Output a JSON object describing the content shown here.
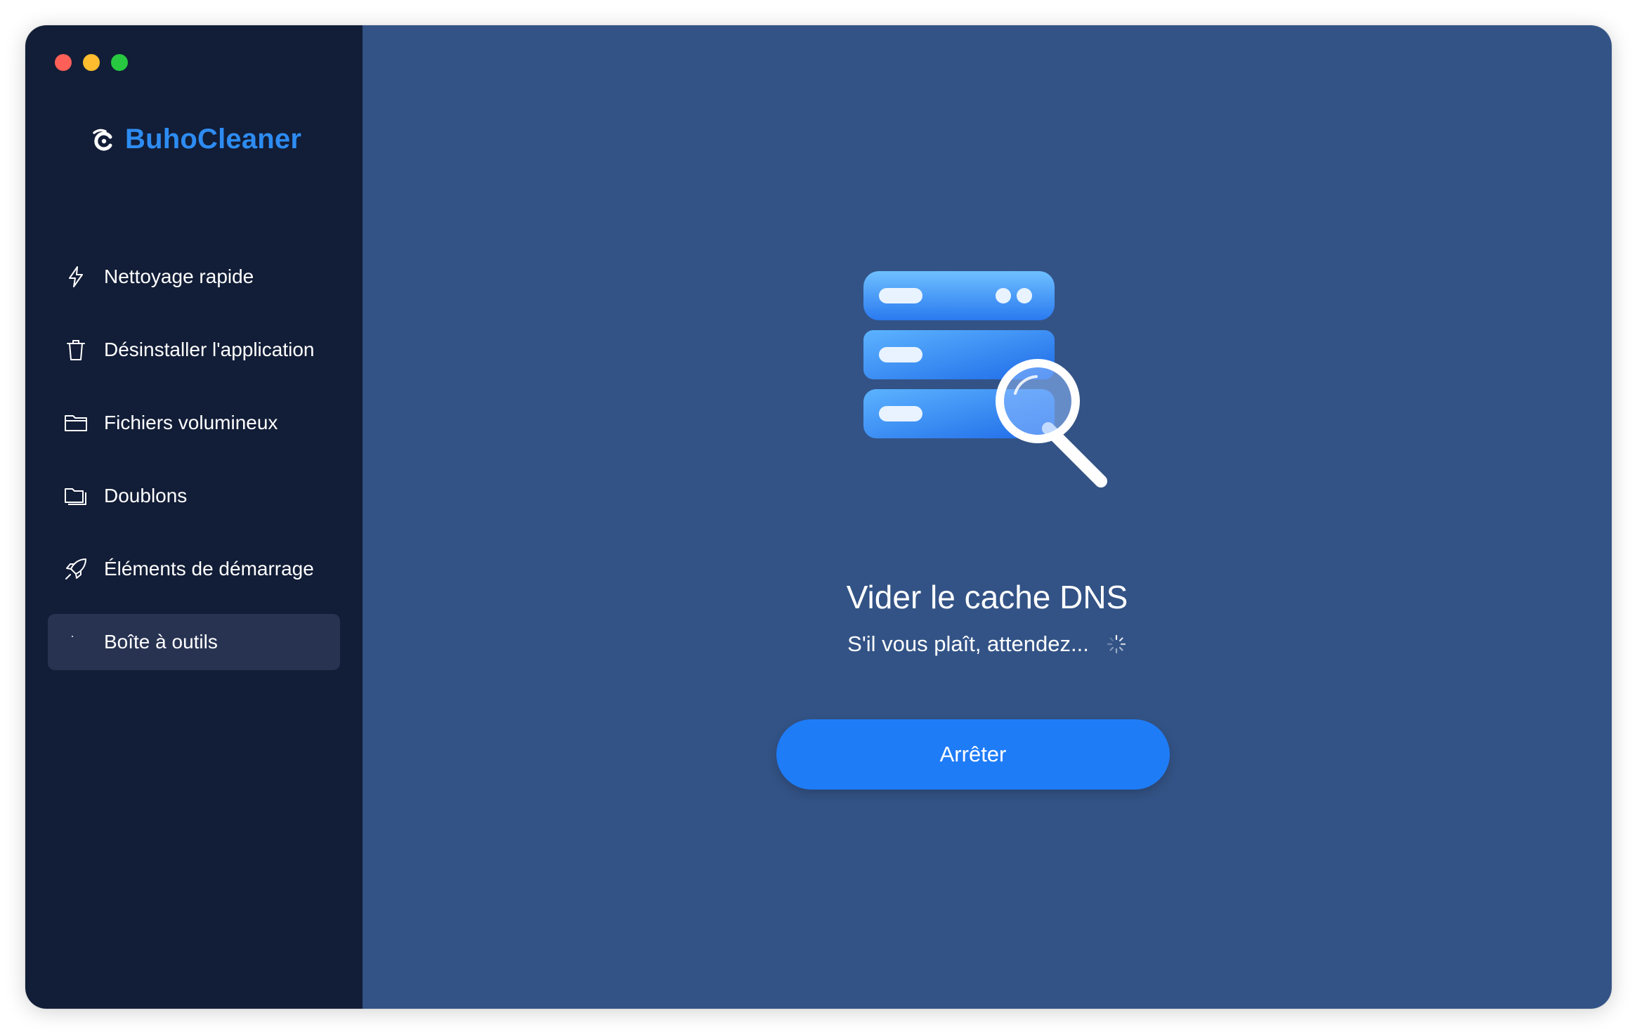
{
  "app": {
    "name": "BuhoCleaner",
    "brand_color": "#2d8cf2"
  },
  "window": {
    "controls": [
      "close",
      "minimize",
      "maximize"
    ],
    "colors": {
      "sidebar_bg": "#121d37",
      "main_bg": "#335386",
      "accent": "#1f7cf7"
    }
  },
  "sidebar": {
    "items": [
      {
        "label": "Nettoyage rapide",
        "icon": "lightning-icon",
        "active": false
      },
      {
        "label": "Désinstaller l'application",
        "icon": "trash-icon",
        "active": false
      },
      {
        "label": "Fichiers volumineux",
        "icon": "folder-icon",
        "active": false
      },
      {
        "label": "Doublons",
        "icon": "duplicate-folder-icon",
        "active": false
      },
      {
        "label": "Éléments de démarrage",
        "icon": "rocket-icon",
        "active": false
      },
      {
        "label": "Boîte à outils",
        "icon": "toolbox-icon",
        "active": true
      }
    ]
  },
  "main": {
    "illustration": "server-magnifier-icon",
    "title": "Vider le cache DNS",
    "status": "S'il vous plaît, attendez...",
    "status_indicator": "spinner-icon",
    "stop_button": "Arrêter"
  }
}
